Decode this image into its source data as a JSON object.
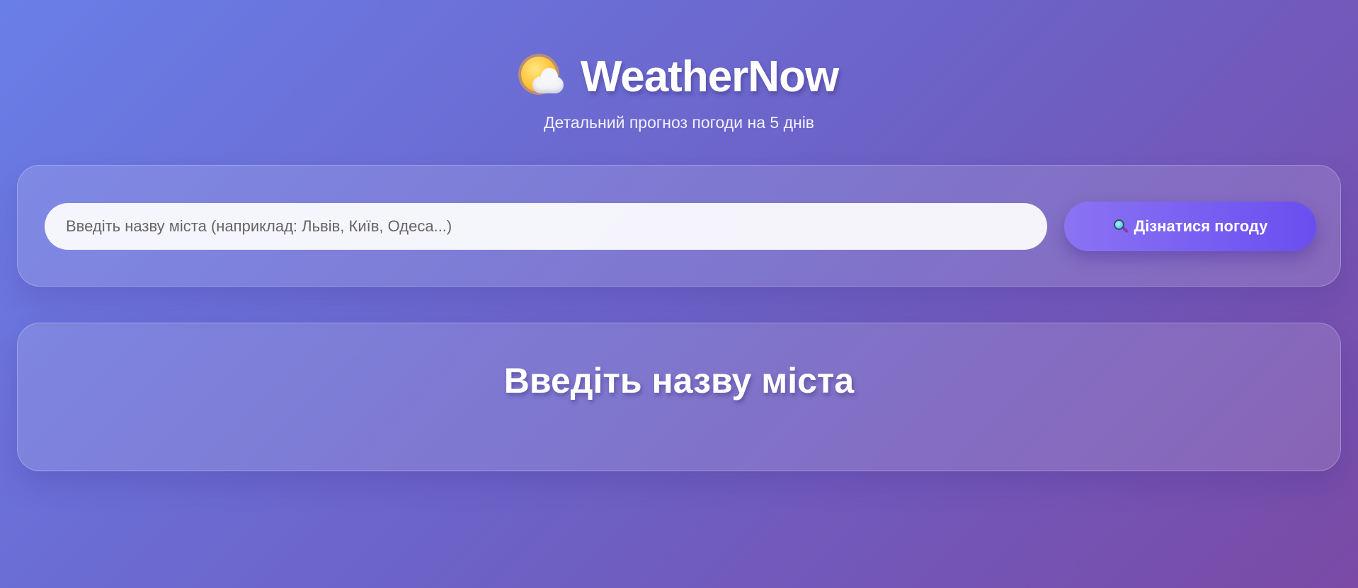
{
  "header": {
    "title": "WeatherNow",
    "subtitle": "Детальний прогноз погоди на 5 днів",
    "logo_icon": "sun-behind-cloud-icon"
  },
  "search": {
    "placeholder": "Введіть назву міста (наприклад: Львів, Київ, Одеса...)",
    "value": "",
    "button_label": "Дізнатися погоду",
    "button_icon": "magnifier-icon"
  },
  "result": {
    "heading": "Введіть назву міста"
  },
  "colors": {
    "background_start": "#6a7ee8",
    "background_end": "#7a4aa6",
    "button_start": "#8b73f3",
    "button_end": "#6a4ef0"
  }
}
